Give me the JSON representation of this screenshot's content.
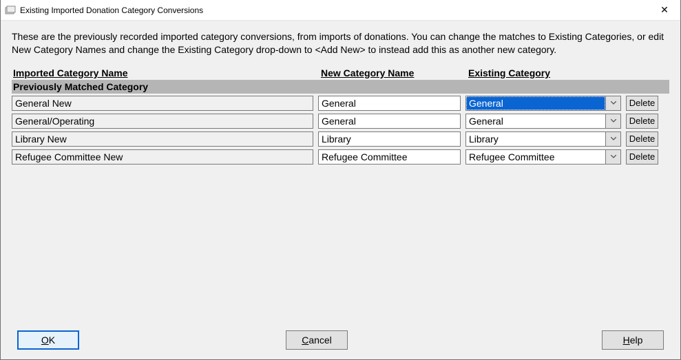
{
  "window": {
    "title": "Existing Imported Donation Category Conversions"
  },
  "intro": "These are the previously recorded imported category conversions, from imports of donations. You can change the matches to Existing Categories, or edit New Category Names and change the Existing Category drop-down to <Add New> to instead add this as another new category.",
  "headers": {
    "imported": "Imported Category Name",
    "newcat": "New Category Name",
    "existing": "Existing Category"
  },
  "section_label": "Previously Matched Category",
  "rows": [
    {
      "imported": "General New",
      "newcat": "General",
      "existing": "General",
      "selected": true
    },
    {
      "imported": "General/Operating",
      "newcat": "General",
      "existing": "General",
      "selected": false
    },
    {
      "imported": "Library New",
      "newcat": "Library",
      "existing": "Library",
      "selected": false
    },
    {
      "imported": "Refugee Committee New",
      "newcat": "Refugee Committee",
      "existing": "Refugee Committee",
      "selected": false
    }
  ],
  "labels": {
    "delete": "Delete",
    "ok": "OK",
    "cancel": "Cancel",
    "help": "Help"
  }
}
